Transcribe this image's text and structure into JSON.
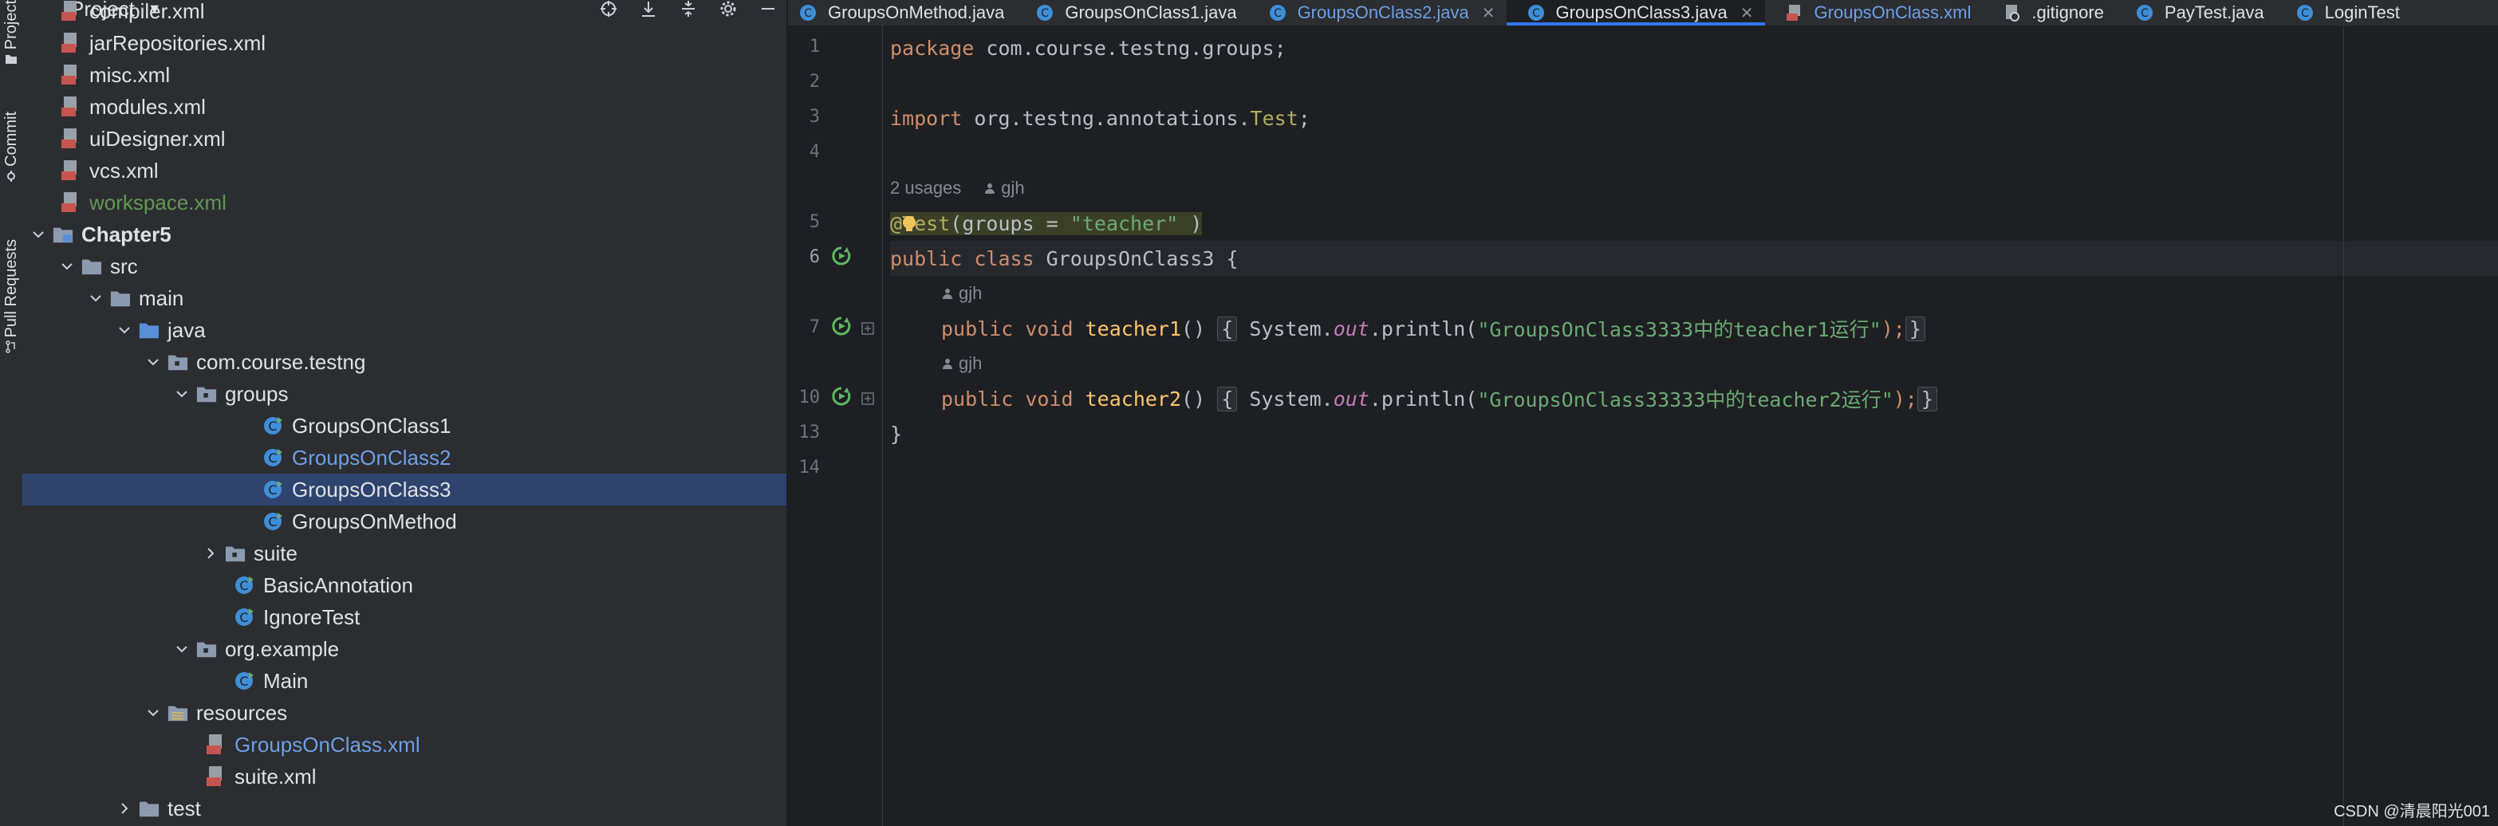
{
  "sidebar_strip": {
    "project_label": "Project",
    "commit_label": "Commit",
    "pull_requests_label": "Pull Requests"
  },
  "project_panel": {
    "title": "Project"
  },
  "tree": {
    "compiler": "compiler.xml",
    "jarRepositories": "jarRepositories.xml",
    "misc": "misc.xml",
    "modules": "modules.xml",
    "uiDesigner": "uiDesigner.xml",
    "vcs": "vcs.xml",
    "workspace": "workspace.xml",
    "chapter5": "Chapter5",
    "src": "src",
    "main": "main",
    "java": "java",
    "pkg": "com.course.testng",
    "groups": "groups",
    "g1": "GroupsOnClass1",
    "g2": "GroupsOnClass2",
    "g3": "GroupsOnClass3",
    "gm": "GroupsOnMethod",
    "suite": "suite",
    "basic": "BasicAnnotation",
    "ignore": "IgnoreTest",
    "orgexample": "org.example",
    "mainclass": "Main",
    "resources": "resources",
    "gxml": "GroupsOnClass.xml",
    "suitexml": "suite.xml",
    "test": "test"
  },
  "tabs": [
    {
      "label": "GroupsOnMethod.java"
    },
    {
      "label": "GroupsOnClass1.java"
    },
    {
      "label": "GroupsOnClass2.java"
    },
    {
      "label": "GroupsOnClass3.java"
    },
    {
      "label": "GroupsOnClass.xml"
    },
    {
      "label": ".gitignore"
    },
    {
      "label": "PayTest.java"
    },
    {
      "label": "LoginTest"
    }
  ],
  "editor": {
    "line_numbers": [
      "1",
      "2",
      "3",
      "4",
      "5",
      "6",
      "7",
      "10",
      "13",
      "14"
    ],
    "usages_hint": "2 usages",
    "author": "gjh",
    "code": {
      "l1_kw": "package",
      "l1_rest": " com.course.testng.groups;",
      "l3_kw": "import",
      "l3_rest": " org.testng.annotations.",
      "l3_cls": "Test",
      "l3_end": ";",
      "l5_at": "@",
      "l5_ann": "Test",
      "l5_open": "(groups = ",
      "l5_str": "\"teacher\"",
      "l5_close": " )",
      "l6_kw1": "public",
      "l6_kw2": " class",
      "l6_name": " GroupsOnClass3",
      "l6_brace": " {",
      "l7_kw": "public void",
      "l7_name": " teacher1",
      "l7_parens": "() ",
      "l7_open": "{",
      "l7_sys": " System.",
      "l7_out": "out",
      "l7_println": ".println(",
      "l7_str": "\"GroupsOnClass3333中的teacher1运行\"",
      "l7_end": ");",
      "l7_close": "}",
      "l10_kw": "public void",
      "l10_name": " teacher2",
      "l10_parens": "() ",
      "l10_open": "{",
      "l10_sys": " System.",
      "l10_out": "out",
      "l10_println": ".println(",
      "l10_str": "\"GroupsOnClass33333中的teacher2运行\"",
      "l10_end": ");",
      "l10_close": "}",
      "l13": "}"
    }
  },
  "watermark": "CSDN @清晨阳光001",
  "colors": {
    "background": "#1e1f22",
    "panel": "#2b2d30",
    "selection": "#2e436e",
    "accent": "#3574f0",
    "keyword": "#cf8e6d",
    "string": "#6aab73",
    "annotation": "#b3ae60"
  }
}
